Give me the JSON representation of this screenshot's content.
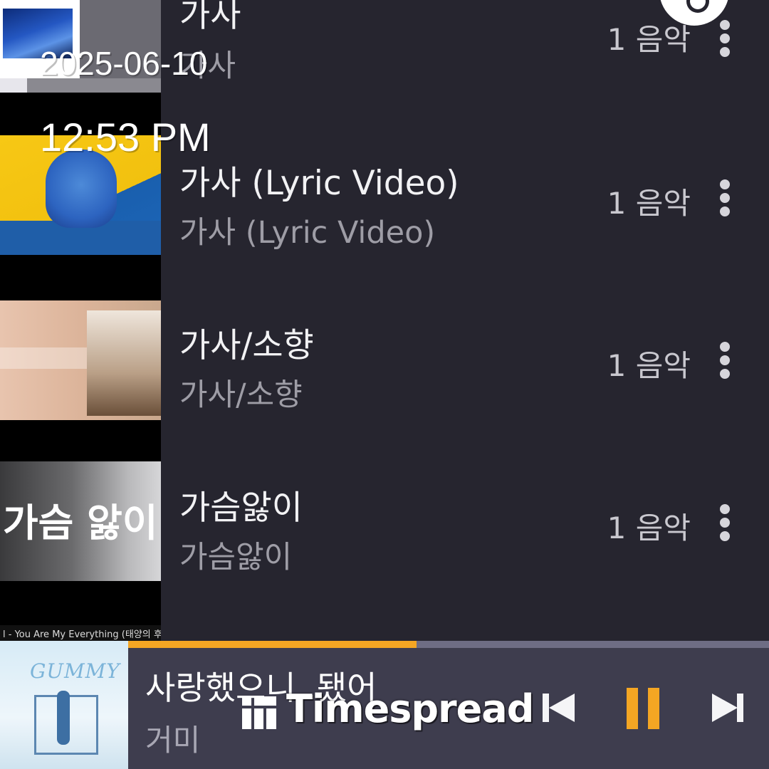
{
  "overlay": {
    "date": "2025-06-10",
    "time": "12:53 PM"
  },
  "list": {
    "items": [
      {
        "title": "가사",
        "subtitle": "가사",
        "count": "1 음악"
      },
      {
        "title": "가사 (Lyric Video)",
        "subtitle": "가사 (Lyric Video)",
        "count": "1 음악"
      },
      {
        "title": "가사/소향",
        "subtitle": "가사/소향",
        "count": "1 음악"
      },
      {
        "title": "가슴앓이",
        "subtitle": "가슴앓이",
        "count": "1 음악"
      }
    ],
    "thumbnails": {
      "item4_text": "가슴 앓이",
      "item5_caption": "l - You Are My Everything (태양의 후예 O"
    }
  },
  "player": {
    "title": "사랑했으니..됐어",
    "artist": "거미",
    "album_logo": "GUMMY",
    "progress": 0.45,
    "accent_color": "#f4a623"
  },
  "watermark": {
    "text": "Timespread"
  },
  "icons": {
    "more": "more-vertical-icon",
    "previous": "skip-previous-icon",
    "pause": "pause-icon",
    "next": "skip-next-icon"
  }
}
